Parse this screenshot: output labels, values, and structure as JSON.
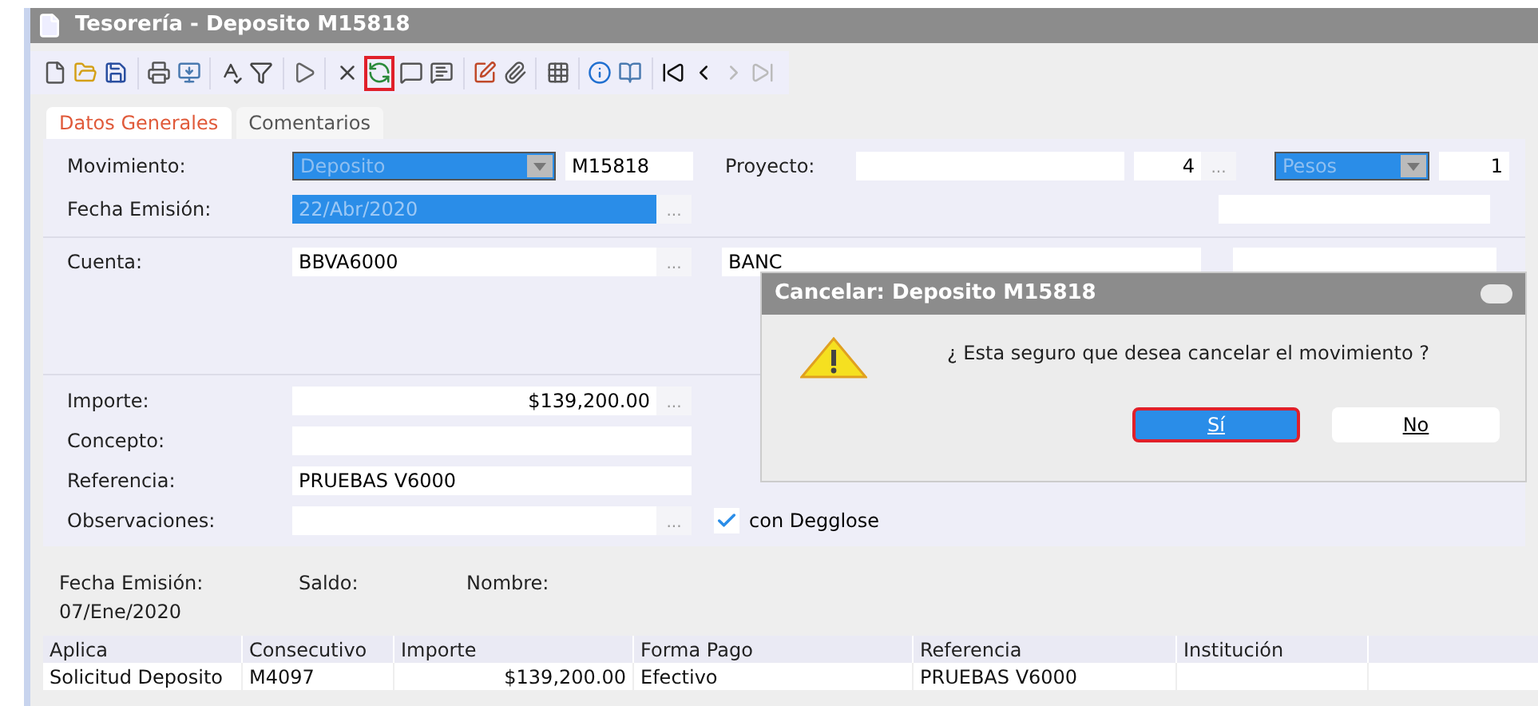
{
  "window": {
    "title": "Tesorería - Deposito M15818"
  },
  "toolbar": [
    {
      "kind": "new",
      "sep": false,
      "highlighted": false,
      "disabled": false
    },
    {
      "kind": "open",
      "sep": false,
      "highlighted": false,
      "disabled": false
    },
    {
      "kind": "save",
      "sep": false,
      "highlighted": false,
      "disabled": false
    },
    {
      "kind": "print",
      "sep": true,
      "highlighted": false,
      "disabled": false
    },
    {
      "kind": "monitor",
      "sep": false,
      "highlighted": false,
      "disabled": false
    },
    {
      "kind": "spell",
      "sep": true,
      "highlighted": false,
      "disabled": false
    },
    {
      "kind": "filter",
      "sep": false,
      "highlighted": false,
      "disabled": false
    },
    {
      "kind": "play",
      "sep": true,
      "highlighted": false,
      "disabled": false
    },
    {
      "kind": "cross",
      "sep": true,
      "highlighted": false,
      "disabled": false
    },
    {
      "kind": "refresh",
      "sep": false,
      "highlighted": true,
      "disabled": false
    },
    {
      "kind": "chat",
      "sep": false,
      "highlighted": false,
      "disabled": false
    },
    {
      "kind": "note",
      "sep": false,
      "highlighted": false,
      "disabled": false
    },
    {
      "kind": "edit",
      "sep": true,
      "highlighted": false,
      "disabled": false
    },
    {
      "kind": "clip",
      "sep": false,
      "highlighted": false,
      "disabled": false
    },
    {
      "kind": "grid",
      "sep": true,
      "highlighted": false,
      "disabled": false
    },
    {
      "kind": "info",
      "sep": true,
      "highlighted": false,
      "disabled": false
    },
    {
      "kind": "book",
      "sep": false,
      "highlighted": false,
      "disabled": false
    },
    {
      "kind": "first",
      "sep": true,
      "highlighted": false,
      "disabled": false
    },
    {
      "kind": "prev",
      "sep": false,
      "highlighted": false,
      "disabled": false
    },
    {
      "kind": "next",
      "sep": false,
      "highlighted": false,
      "disabled": true
    },
    {
      "kind": "last",
      "sep": false,
      "highlighted": false,
      "disabled": true
    }
  ],
  "tabs": [
    {
      "label": "Datos Generales",
      "selected": true
    },
    {
      "label": "Comentarios",
      "selected": false
    }
  ],
  "form": {
    "movimiento": {
      "label": "Movimiento:",
      "value": "Deposito",
      "number": "M15818"
    },
    "proyecto": {
      "label": "Proyecto:",
      "number": "4",
      "button": "..."
    },
    "moneda": {
      "value": "Pesos",
      "rate": "1"
    },
    "fecha": {
      "label": "Fecha Emisión:",
      "value": "22/Abr/2020",
      "button": "..."
    },
    "cuenta": {
      "label": "Cuenta:",
      "value": "BBVA6000",
      "bank": "BANC",
      "button": "..."
    },
    "importe": {
      "label": "Importe:",
      "value": "$139,200.00",
      "button": "..."
    },
    "concepto": {
      "label": "Concepto:"
    },
    "referencia": {
      "label": "Referencia:",
      "value": "PRUEBAS V6000"
    },
    "observaciones": {
      "label": "Observaciones:",
      "button": "..."
    },
    "desglose": {
      "label": "con Degglose",
      "checked": true
    }
  },
  "summary": [
    {
      "label": "Fecha Emisión:",
      "value": "07/Ene/2020"
    },
    {
      "label": "Saldo:"
    },
    {
      "label": "Nombre:"
    }
  ],
  "table": {
    "columns": [
      "Aplica",
      "Consecutivo",
      "Importe",
      "Forma Pago",
      "Referencia",
      "Institución"
    ],
    "rows": [
      [
        "Solicitud Deposito",
        "M4097",
        "$139,200.00",
        "Efectivo",
        "PRUEBAS V6000",
        ""
      ]
    ]
  },
  "dialog": {
    "title": "Cancelar: Deposito M15818",
    "message": "¿ Esta seguro que desea cancelar el movimiento ?",
    "buttons": [
      {
        "label": "Sí",
        "selected": true
      },
      {
        "label": "No",
        "selected": false
      }
    ]
  }
}
